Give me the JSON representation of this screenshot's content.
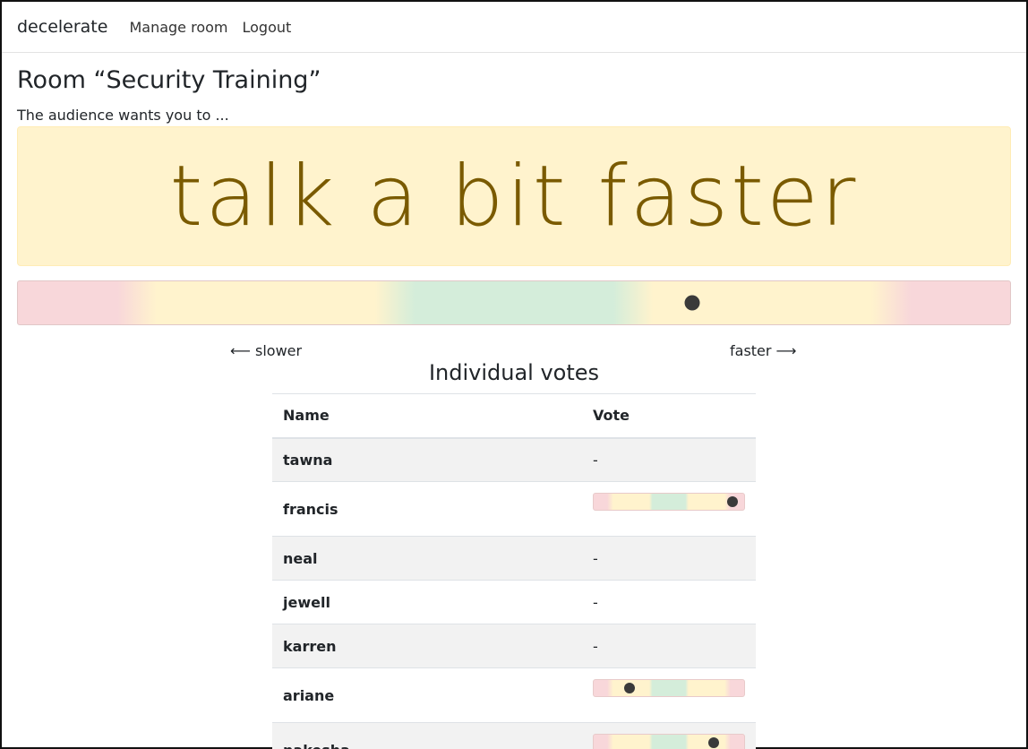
{
  "navbar": {
    "brand": "decelerate",
    "links": [
      "Manage room",
      "Logout"
    ]
  },
  "room": {
    "title": "Room “Security Training”",
    "lead": "The audience wants you to ..."
  },
  "status": {
    "message": "talk a bit faster"
  },
  "meter": {
    "value": 0.68
  },
  "labels": {
    "slower": "⟵ slower",
    "faster": "faster ⟶"
  },
  "votes": {
    "heading": "Individual votes",
    "columns": [
      "Name",
      "Vote"
    ],
    "rows": [
      {
        "name": "tawna",
        "vote": "-"
      },
      {
        "name": "francis",
        "vote": 0.92
      },
      {
        "name": "neal",
        "vote": "-"
      },
      {
        "name": "jewell",
        "vote": "-"
      },
      {
        "name": "karren",
        "vote": "-"
      },
      {
        "name": "ariane",
        "vote": 0.24
      },
      {
        "name": "nakesha",
        "vote": 0.8
      }
    ]
  }
}
